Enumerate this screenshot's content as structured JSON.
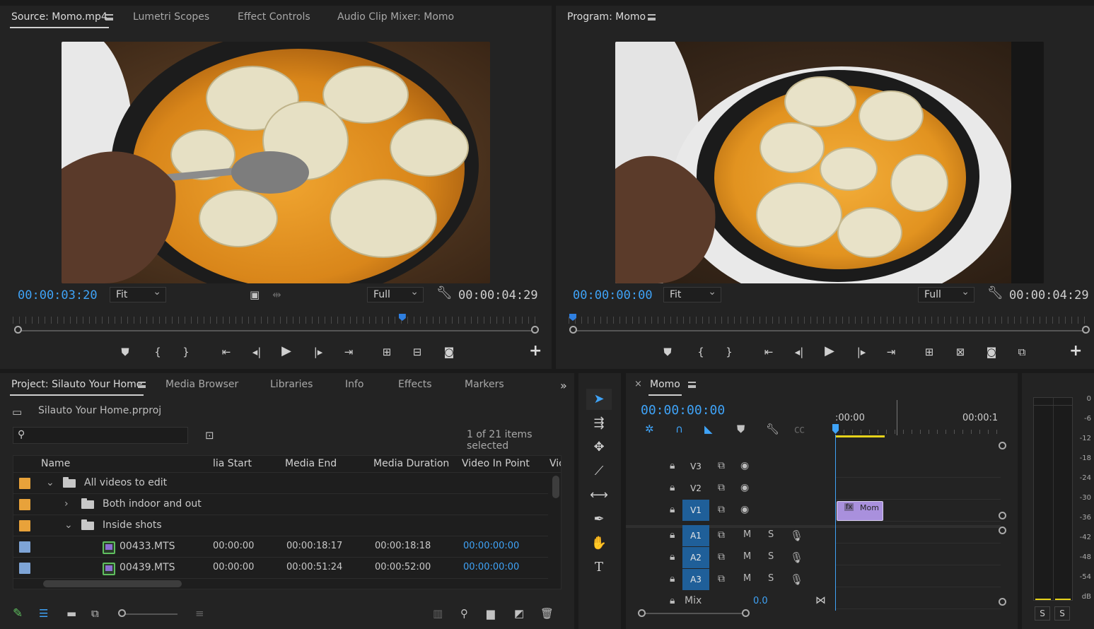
{
  "source_monitor": {
    "tabs": [
      "Source: Momo.mp4",
      "Lumetri Scopes",
      "Effect Controls",
      "Audio Clip Mixer: Momo"
    ],
    "timecode": "00:00:03:20",
    "zoom": "Fit",
    "resolution": "Full",
    "duration": "00:00:04:29",
    "playhead_fraction": 0.745
  },
  "program_monitor": {
    "title": "Program: Momo",
    "timecode": "00:00:00:00",
    "zoom": "Fit",
    "resolution": "Full",
    "duration": "00:00:04:29",
    "playhead_fraction": 0.0
  },
  "project": {
    "tabs": [
      "Project: Silauto Your Home",
      "Media Browser",
      "Libraries",
      "Info",
      "Effects",
      "Markers"
    ],
    "file": "Silauto Your Home.prproj",
    "search_placeholder": "",
    "selection_status": "1 of 21 items selected",
    "columns": [
      "Name",
      "lia Start",
      "Media End",
      "Media Duration",
      "Video In Point",
      "Vic"
    ],
    "rows": [
      {
        "name": "All videos to edit",
        "kind": "folder",
        "expanded": true,
        "indent": 0,
        "color": "#e8a23a"
      },
      {
        "name": "Both indoor and out",
        "kind": "folder",
        "expanded": false,
        "indent": 1,
        "color": "#e8a23a"
      },
      {
        "name": "Inside shots",
        "kind": "folder",
        "expanded": true,
        "indent": 1,
        "color": "#e8a23a"
      },
      {
        "name": "00433.MTS",
        "kind": "clip",
        "indent": 2,
        "color": "#7ea4d6",
        "start": "00:00:00",
        "end": "00:00:18:17",
        "duration": "00:00:18:18",
        "in": "00:00:00:00"
      },
      {
        "name": "00439.MTS",
        "kind": "clip",
        "indent": 2,
        "color": "#7ea4d6",
        "start": "00:00:00",
        "end": "00:00:51:24",
        "duration": "00:00:52:00",
        "in": "00:00:00:00"
      }
    ]
  },
  "timeline": {
    "title": "Momo",
    "timecode": "00:00:00:00",
    "ruler": [
      ":00:00",
      "00:00:1"
    ],
    "video_tracks": [
      "V3",
      "V2",
      "V1"
    ],
    "audio_tracks": [
      "A1",
      "A2",
      "A3"
    ],
    "mute_label": "M",
    "solo_label": "S",
    "mix_label": "Mix",
    "mix_value": "0.0",
    "clip_label": "Mom",
    "clip_fx": "fx"
  },
  "meter": {
    "scale": [
      "0",
      "-6",
      "-12",
      "-18",
      "-24",
      "-30",
      "-36",
      "-42",
      "-48",
      "-54",
      "dB"
    ],
    "solo_buttons": [
      "S",
      "S"
    ]
  },
  "colors": {
    "accent": "#3fa3f7",
    "folder": "#e8a23a",
    "clip_label": "#7ea4d6",
    "clip": "#a990dd",
    "track_on": "#1f5f99"
  }
}
